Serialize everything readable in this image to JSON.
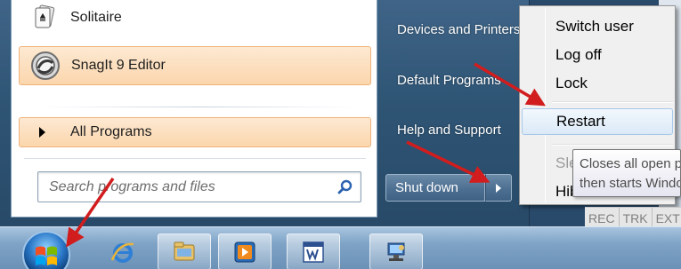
{
  "start_menu": {
    "programs": [
      {
        "label": "Solitaire",
        "icon": "solitaire-icon"
      },
      {
        "label": "SnagIt 9 Editor",
        "icon": "snagit-icon"
      }
    ],
    "all_programs_label": "All Programs",
    "search_placeholder": "Search programs and files",
    "right_items": [
      {
        "label": "Devices and Printers"
      },
      {
        "label": "Default Programs"
      },
      {
        "label": "Help and Support"
      }
    ],
    "shutdown_label": "Shut down"
  },
  "context_menu": {
    "items": [
      {
        "label": "Switch user"
      },
      {
        "label": "Log off"
      },
      {
        "label": "Lock"
      },
      {
        "label": "Restart"
      },
      {
        "label": "Sleep"
      },
      {
        "label": "Hibernate"
      }
    ]
  },
  "tooltip": {
    "line1": "Closes all open programs, shuts down Windows,",
    "line2": "then starts Windows again."
  },
  "status_indicators": [
    "REC",
    "TRK",
    "EXT"
  ],
  "taskbar": {
    "buttons": [
      {
        "icon": "internet-explorer-icon"
      },
      {
        "icon": "windows-explorer-icon"
      },
      {
        "icon": "media-player-icon"
      },
      {
        "icon": "word-icon"
      },
      {
        "icon": "network-icon"
      }
    ]
  },
  "colors": {
    "accent_arrow": "#d11d1d",
    "menu_highlight": "#dbe9f7",
    "program_highlight": "#fbd6ad"
  }
}
